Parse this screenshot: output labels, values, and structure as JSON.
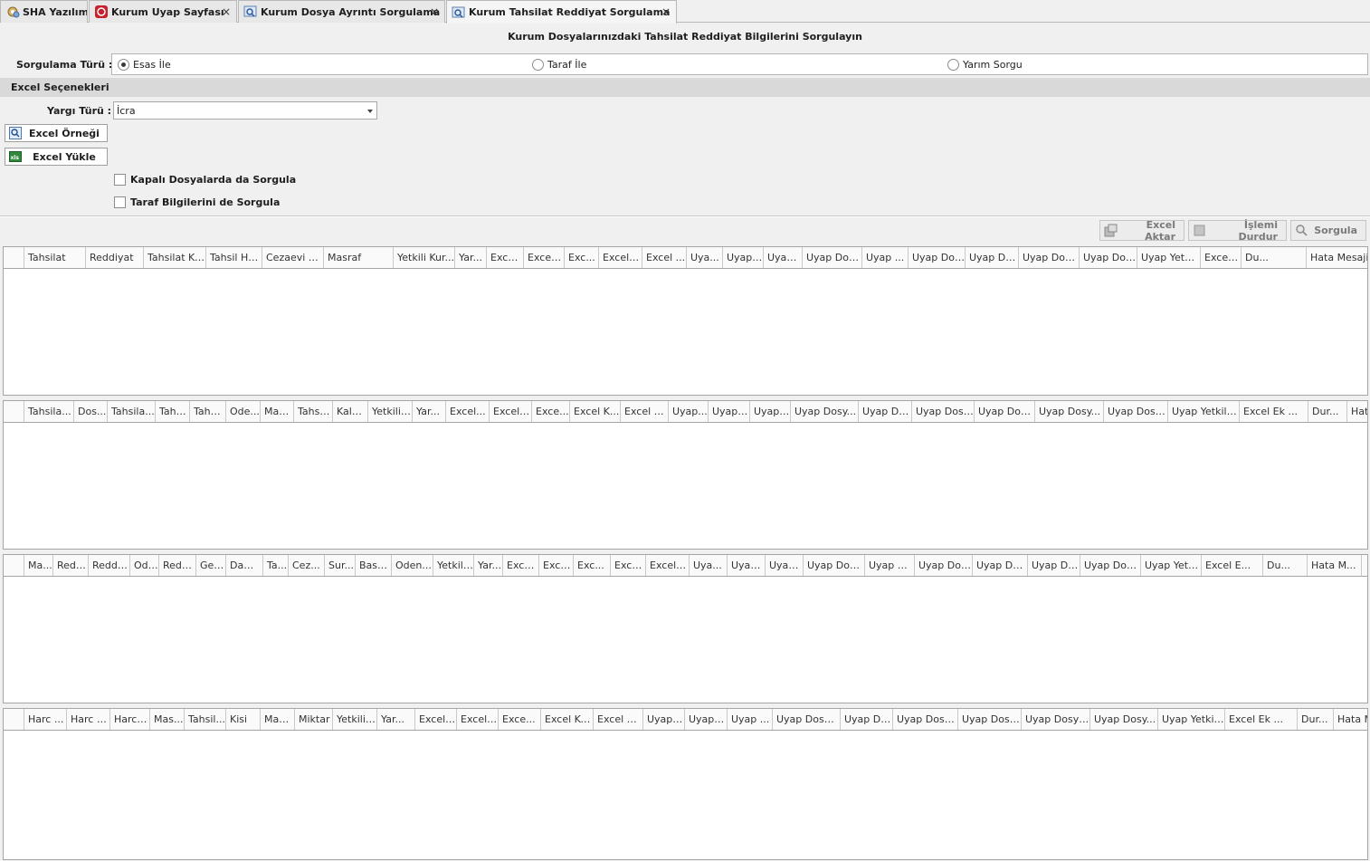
{
  "tabs": [
    {
      "label": "SHA Yazılım",
      "icon": "gear-icon",
      "closable": false,
      "active": false
    },
    {
      "label": "Kurum Uyap Sayfası",
      "icon": "uyap-logo-icon",
      "closable": true,
      "active": false
    },
    {
      "label": "Kurum Dosya Ayrıntı Sorgulama",
      "icon": "search-window-icon",
      "closable": true,
      "active": false
    },
    {
      "label": "Kurum Tahsilat Reddiyat Sorgulama",
      "icon": "search-window-icon",
      "closable": true,
      "active": true
    }
  ],
  "page_title": "Kurum Dosyalarınızdaki Tahsilat Reddiyat Bilgilerini Sorgulayın",
  "query_type": {
    "label": "Sorgulama Türü :",
    "options": [
      "Esas İle",
      "Taraf İle",
      "Yarım Sorgu"
    ],
    "selected": "Esas İle"
  },
  "excel_section": {
    "title": "Excel Seçenekleri",
    "jurisdiction_label": "Yargı Türü :",
    "jurisdiction_value": "İcra",
    "sample_button": "Excel Örneği",
    "upload_button": "Excel Yükle",
    "closed_files_check": "Kapalı Dosyalarda da Sorgula",
    "party_info_check": "Taraf Bilgilerini de Sorgula",
    "closed_files_checked": false,
    "party_info_checked": false
  },
  "toolbar": {
    "export": "Excel Aktar",
    "stop": "İşlemi Durdur",
    "query": "Sorgula"
  },
  "grids": [
    {
      "columns": [
        "Tahsilat",
        "Reddiyat",
        "Tahsilat Ka...",
        "Tahsil Harci",
        "Cezaevi H...",
        "Masraf",
        "Yetkili Kur...",
        "Yar...",
        "Exce...",
        "Excel ...",
        "Exc...",
        "Excel ...",
        "Excel ...",
        "Uya...",
        "Uyap ...",
        "Uyap...",
        "Uyap Dos...",
        "Uyap ...",
        "Uyap Dos...",
        "Uyap Do...",
        "Uyap Dos...",
        "Uyap Dos...",
        "Uyap Yetkil...",
        "Excel E...",
        "Du...",
        "Hata Mesaji"
      ]
    },
    {
      "columns": [
        "Tahsila...",
        "Dos...",
        "Tahsila...",
        "Tahs...",
        "Tahsi...",
        "Ode...",
        "Mak...",
        "Tahsil...",
        "Kala...",
        "Yetkili ...",
        "Yar...",
        "Excel...",
        "Excel ...",
        "Exce...",
        "Excel K...",
        "Excel K...",
        "Uyap...",
        "Uyap ...",
        "Uyap ...",
        "Uyap Dosy...",
        "Uyap Do...",
        "Uyap Dosy...",
        "Uyap Dos...",
        "Uyap Dosy...",
        "Uyap Dosy...",
        "Uyap Yetkili ...",
        "Excel Ek ...",
        "Dur...",
        "Hata Me..."
      ]
    },
    {
      "columns": [
        "Ma...",
        "Redd...",
        "Reddi...",
        "Ode...",
        "Reddi...",
        "Geli...",
        "Dam...",
        "Ta...",
        "Cez...",
        "Sur...",
        "Basv...",
        "Oden...",
        "Yetkili...",
        "Yar...",
        "Exce...",
        "Excel...",
        "Exc...",
        "Excel K...",
        "Excel ...",
        "Uya...",
        "Uyap...",
        "Uyap...",
        "Uyap Dos...",
        "Uyap D...",
        "Uyap Dos...",
        "Uyap Do...",
        "Uyap Dos...",
        "Uyap Dos...",
        "Uyap Yetkil...",
        "Excel E...",
        "Du...",
        "Hata M..."
      ]
    },
    {
      "columns": [
        "Harc ...",
        "Harc D...",
        "Harc ...",
        "Mas...",
        "Tahsil...",
        "Kisi",
        "Mak...",
        "Miktar",
        "Yetkili ...",
        "Yar...",
        "Excel ...",
        "Excel ...",
        "Exce...",
        "Excel Ku...",
        "Excel K...",
        "Uyap ...",
        "Uyap ...",
        "Uyap ...",
        "Uyap Dosya...",
        "Uyap Do...",
        "Uyap Dosy...",
        "Uyap Dosy...",
        "Uyap Dosya...",
        "Uyap Dosy...",
        "Uyap Yetkili ...",
        "Excel Ek ...",
        "Dur...",
        "Hata M..."
      ]
    }
  ]
}
